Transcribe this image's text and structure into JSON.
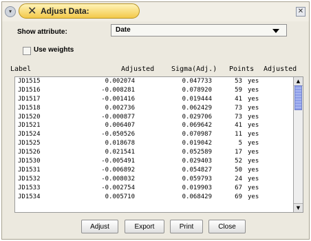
{
  "window": {
    "title": "Adjust Data:",
    "collapse_glyph": "▾",
    "close_glyph": "✕",
    "title_glyph": "✕"
  },
  "controls": {
    "show_attribute_label": "Show attribute:",
    "show_attribute_value": "Date",
    "use_weights_label": "Use weights",
    "use_weights_checked": false
  },
  "table": {
    "headers": [
      "Label",
      "Adjusted",
      "Sigma(Adj.)",
      "Points",
      "Adjusted"
    ],
    "rows": [
      [
        "JD1515",
        "0.002074",
        "0.047733",
        "53",
        "yes"
      ],
      [
        "JD1516",
        "-0.008281",
        "0.078920",
        "59",
        "yes"
      ],
      [
        "JD1517",
        "-0.001416",
        "0.019444",
        "41",
        "yes"
      ],
      [
        "JD1518",
        "0.002736",
        "0.062429",
        "73",
        "yes"
      ],
      [
        "JD1520",
        "-0.000877",
        "0.029706",
        "73",
        "yes"
      ],
      [
        "JD1521",
        "0.006407",
        "0.069642",
        "41",
        "yes"
      ],
      [
        "JD1524",
        "-0.050526",
        "0.070987",
        "11",
        "yes"
      ],
      [
        "JD1525",
        "0.018678",
        "0.019042",
        "5",
        "yes"
      ],
      [
        "JD1526",
        "0.021541",
        "0.052589",
        "17",
        "yes"
      ],
      [
        "JD1530",
        "-0.005491",
        "0.029403",
        "52",
        "yes"
      ],
      [
        "JD1531",
        "-0.006892",
        "0.054827",
        "50",
        "yes"
      ],
      [
        "JD1532",
        "-0.008032",
        "0.059793",
        "24",
        "yes"
      ],
      [
        "JD1533",
        "-0.002754",
        "0.019903",
        "67",
        "yes"
      ],
      [
        "JD1534",
        "0.005710",
        "0.068429",
        "69",
        "yes"
      ]
    ]
  },
  "buttons": {
    "adjust": "Adjust",
    "export": "Export",
    "print": "Print",
    "close": "Close"
  },
  "colors": {
    "title_tab_bg": "#f3c94a",
    "scrollbar_thumb": "#8d9ee8",
    "window_bg": "#ece9df"
  }
}
